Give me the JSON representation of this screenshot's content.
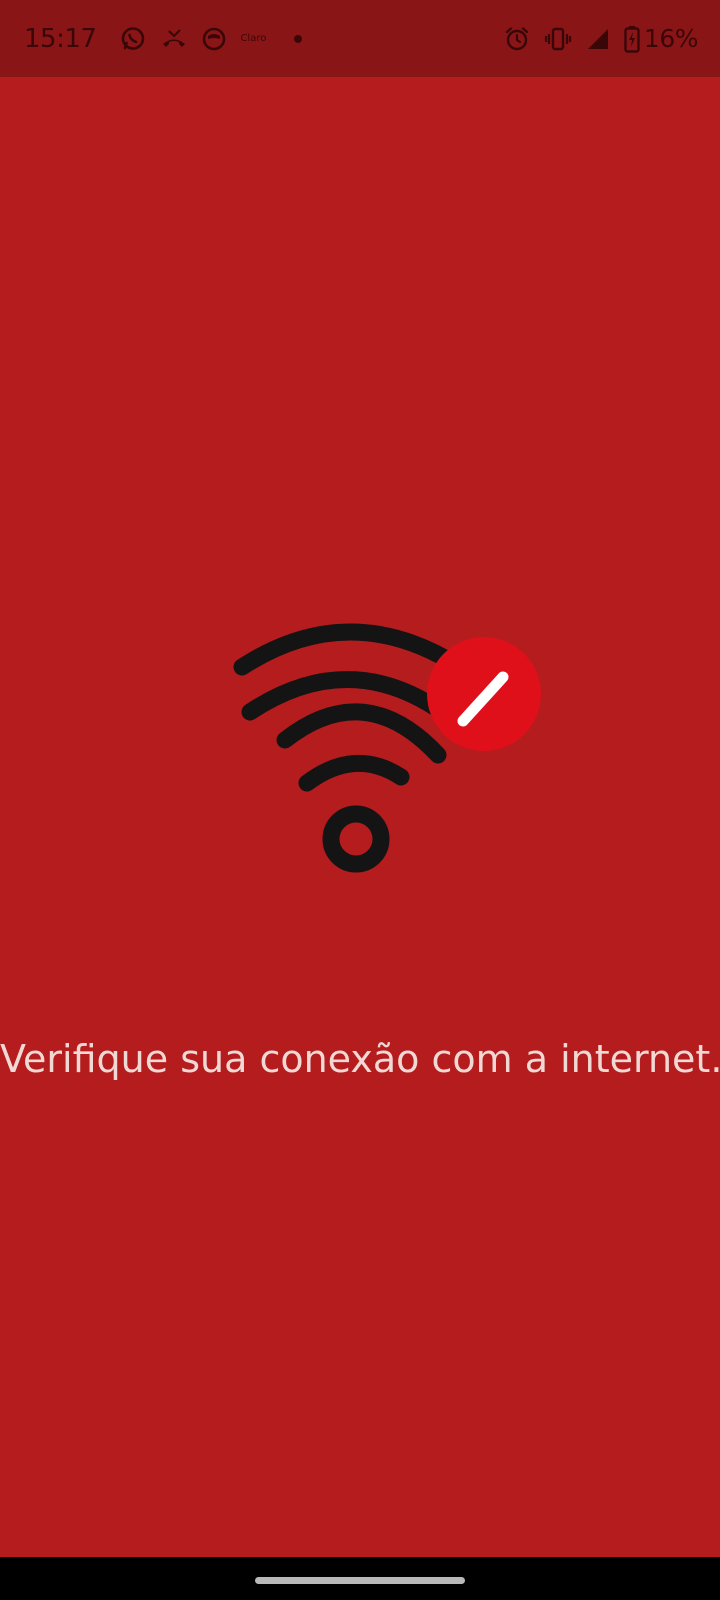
{
  "status_bar": {
    "time": "15:17",
    "carrier": "Claro",
    "battery": "16%",
    "icons": [
      "whatsapp-icon",
      "missed-call-icon",
      "app-icon",
      "carrier-icon",
      "dot-icon",
      "alarm-icon",
      "vibrate-icon",
      "signal-icon",
      "battery-charging-icon"
    ]
  },
  "main": {
    "illustration": "wifi-off-icon",
    "message": "Verifique sua conexão com a internet."
  },
  "colors": {
    "background": "#b41c1e",
    "status_bar": "#8a1517",
    "badge": "#e0101b",
    "wifi_arcs": "#141414",
    "message_text": "#f0d9d4"
  }
}
